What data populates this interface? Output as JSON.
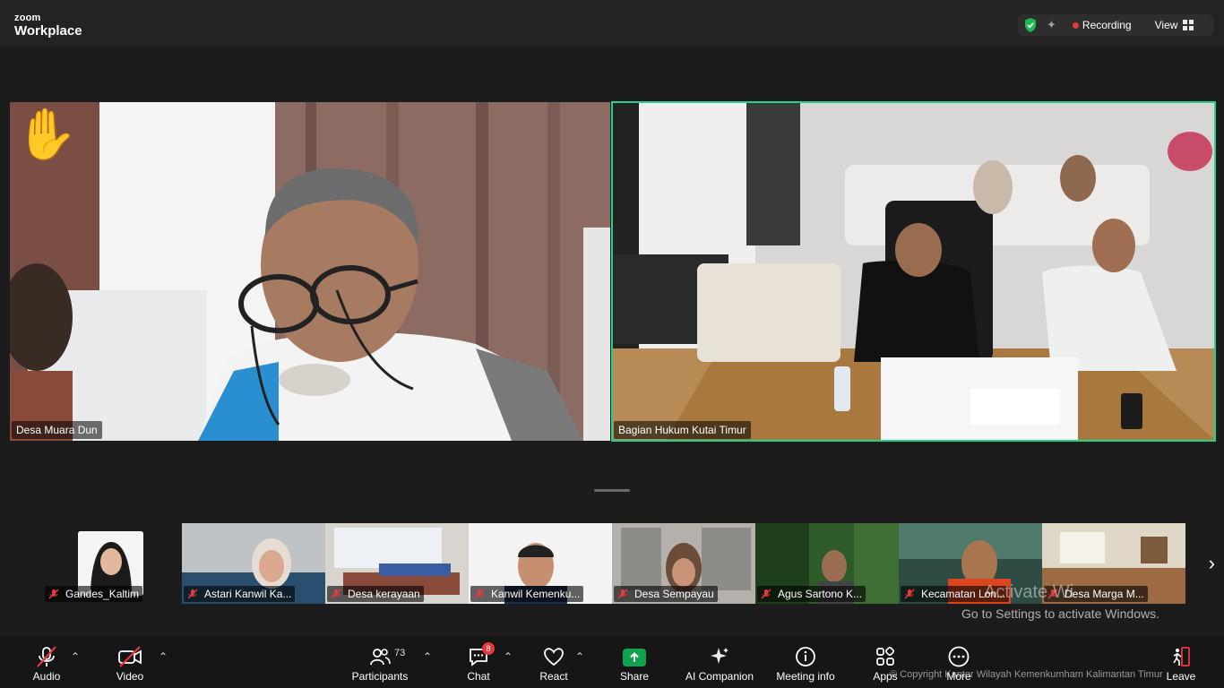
{
  "app": {
    "brand_small": "zoom",
    "brand_big": "Workplace"
  },
  "topbar": {
    "recording_label": "Recording",
    "view_label": "View"
  },
  "main_videos": [
    {
      "name": "Desa Muara Dun",
      "reaction": "✋"
    },
    {
      "name": "Bagian Hukum Kutai Timur",
      "active_speaker": true
    }
  ],
  "strip": {
    "avatar_tile": {
      "name": "Gandes_Kaltim"
    },
    "thumbs": [
      {
        "name": "Astari Kanwil Ka..."
      },
      {
        "name": "Desa kerayaan"
      },
      {
        "name": "Kanwil Kemenku..."
      },
      {
        "name": "Desa Sempayau"
      },
      {
        "name": "Agus Sartono K..."
      },
      {
        "name": "Kecamatan Lon..."
      },
      {
        "name": "Desa Marga M..."
      }
    ]
  },
  "watermark": {
    "line1": "Activate Wi",
    "line2": "Go to Settings to activate Windows."
  },
  "toolbar": {
    "audio": "Audio",
    "video": "Video",
    "participants": "Participants",
    "participants_count": "73",
    "chat": "Chat",
    "chat_badge": "8",
    "react": "React",
    "share": "Share",
    "ai_companion": "AI Companion",
    "meeting_info": "Meeting info",
    "apps": "Apps",
    "more": "More",
    "leave": "Leave"
  },
  "copyright": "© Copyright Kantor Wilayah Kemenkumham Kalimantan Timur",
  "colors": {
    "active_speaker": "#23d18b",
    "recording_dot": "#e8383d",
    "share_green": "#0fa34d",
    "muted_red": "#e8383d"
  }
}
